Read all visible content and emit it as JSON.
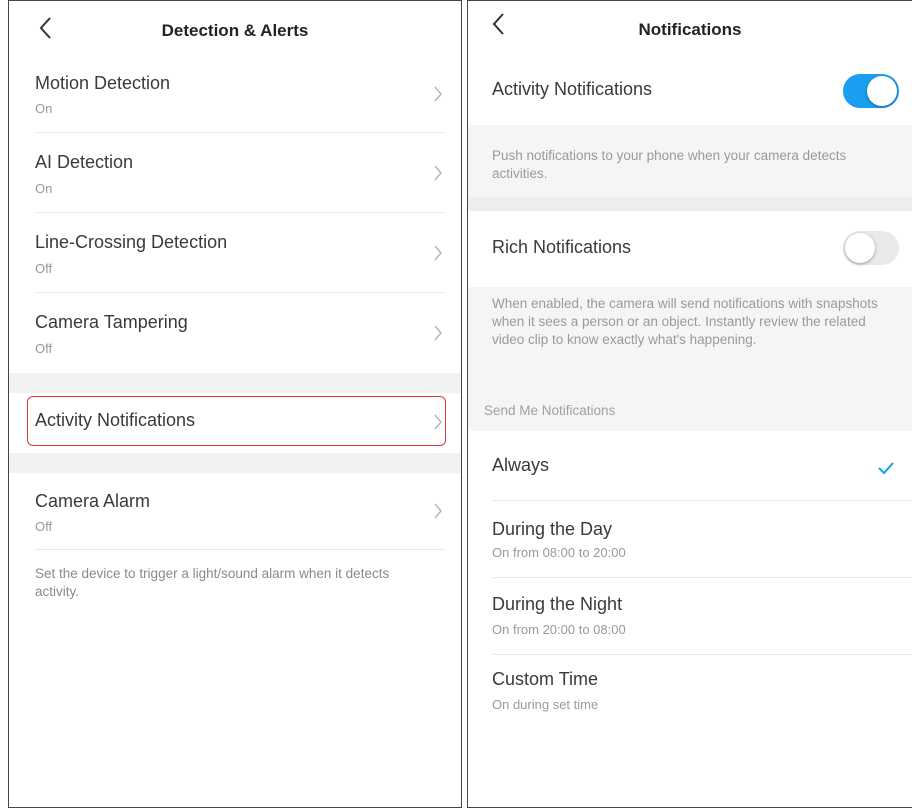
{
  "left": {
    "title": "Detection & Alerts",
    "items": [
      {
        "label": "Motion Detection",
        "sub": "On"
      },
      {
        "label": "AI Detection",
        "sub": "On"
      },
      {
        "label": "Line-Crossing Detection",
        "sub": "Off"
      },
      {
        "label": "Camera Tampering",
        "sub": "Off"
      },
      {
        "label": "Activity Notifications"
      },
      {
        "label": "Camera Alarm",
        "sub": "Off"
      }
    ],
    "alarm_description": "Set the device to trigger a light/sound alarm when it detects activity."
  },
  "right": {
    "title": "Notifications",
    "activity": {
      "label": "Activity Notifications",
      "enabled": true,
      "description": "Push notifications to your phone when your camera detects activities."
    },
    "rich": {
      "label": "Rich Notifications",
      "enabled": false,
      "description": "When enabled, the camera will send notifications with snapshots when it sees a person or an object. Instantly review the related video clip to know exactly what's happening."
    },
    "send_header": "Send Me Notifications",
    "options": [
      {
        "label": "Always",
        "sub": "",
        "selected": true
      },
      {
        "label": "During the Day",
        "sub": "On from 08:00 to 20:00",
        "selected": false
      },
      {
        "label": "During the Night",
        "sub": "On from 20:00 to 08:00",
        "selected": false
      },
      {
        "label": "Custom Time",
        "sub": "On during set time",
        "selected": false
      }
    ]
  },
  "colors": {
    "accent": "#1a9ff0",
    "highlight": "#d9363e",
    "section_bg": "#f2f2f2"
  }
}
